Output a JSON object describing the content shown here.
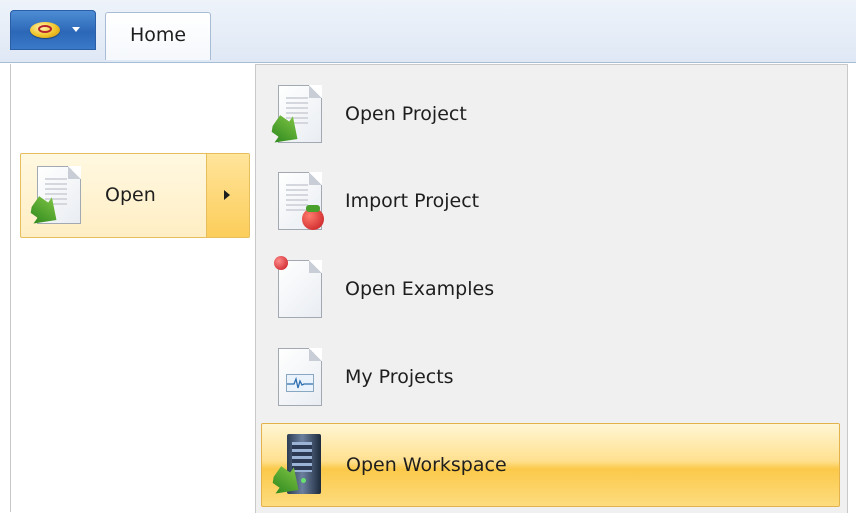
{
  "ribbon": {
    "tabs": [
      {
        "label": "Home"
      }
    ]
  },
  "menu": {
    "left": {
      "items": [
        {
          "label": "Open",
          "icon": "open-document-icon",
          "has_submenu": true
        }
      ]
    },
    "submenu": {
      "items": [
        {
          "label": "Open Project",
          "icon": "open-project-icon"
        },
        {
          "label": "Import Project",
          "icon": "import-project-icon"
        },
        {
          "label": "Open Examples",
          "icon": "open-examples-icon"
        },
        {
          "label": "My Projects",
          "icon": "my-projects-icon"
        },
        {
          "label": "Open Workspace",
          "icon": "workspace-server-icon"
        }
      ]
    }
  },
  "colors": {
    "ribbon_bg": "#dfe8f5",
    "app_button": "#2c67b7",
    "hover_highlight": "#fbc94a",
    "submenu_bg": "#f0f0f0"
  }
}
